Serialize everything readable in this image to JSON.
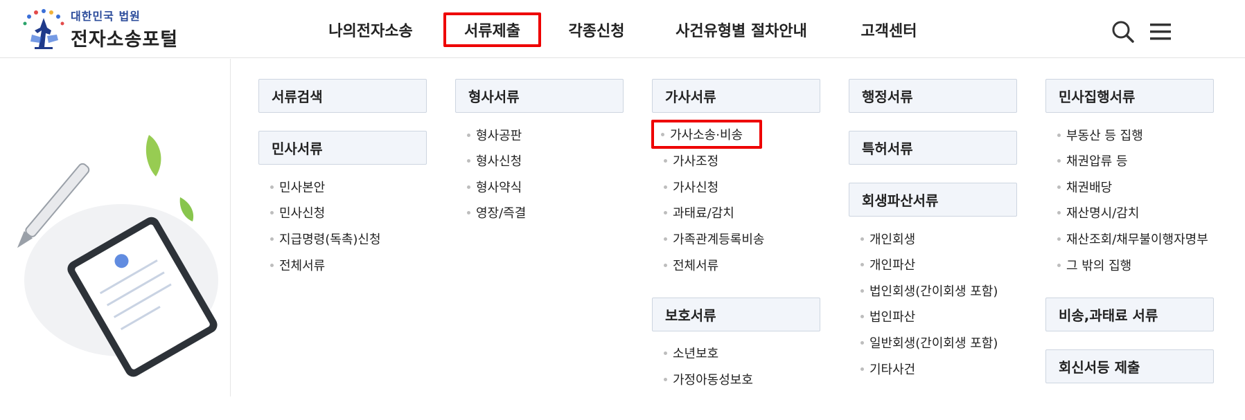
{
  "header": {
    "logo_sub": "대한민국 법원",
    "logo_main": "전자소송포털",
    "nav": [
      {
        "label": "나의전자소송",
        "active": false
      },
      {
        "label": "서류제출",
        "active": true
      },
      {
        "label": "각종신청",
        "active": false
      },
      {
        "label": "사건유형별 절차안내",
        "active": false
      },
      {
        "label": "고객센터",
        "active": false
      }
    ],
    "icons": [
      "search-icon",
      "hamburger-menu-icon"
    ]
  },
  "menu": {
    "col1": {
      "search_box": "서류검색",
      "civil": {
        "title": "민사서류",
        "items": [
          "민사본안",
          "민사신청",
          "지급명령(독촉)신청",
          "전체서류"
        ]
      }
    },
    "col2": {
      "criminal": {
        "title": "형사서류",
        "items": [
          "형사공판",
          "형사신청",
          "형사약식",
          "영장/즉결"
        ]
      }
    },
    "col3": {
      "family": {
        "title": "가사서류",
        "items": [
          "가사소송·비송",
          "가사조정",
          "가사신청",
          "과태료/감치",
          "가족관계등록비송",
          "전체서류"
        ],
        "highlighted_item": "가사소송·비송"
      },
      "protection": {
        "title": "보호서류",
        "items": [
          "소년보호",
          "가정아동성보호"
        ]
      }
    },
    "col4": {
      "administrative": {
        "title": "행정서류"
      },
      "patent": {
        "title": "특허서류"
      },
      "rehab": {
        "title": "회생파산서류",
        "items": [
          "개인회생",
          "개인파산",
          "법인회생(간이회생 포함)",
          "법인파산",
          "일반회생(간이회생 포함)",
          "기타사건"
        ]
      }
    },
    "col5": {
      "civil_exec": {
        "title": "민사집행서류",
        "items": [
          "부동산 등 집행",
          "채권압류 등",
          "채권배당",
          "재산명시/감치",
          "재산조회/채무불이행자명부",
          "그 밖의 집행"
        ]
      },
      "noncontentious": {
        "title": "비송,과태료 서류"
      },
      "reply": {
        "title": "회신서등 제출"
      }
    }
  },
  "colors": {
    "highlight_border": "#ee0000",
    "box_bg": "#f2f5fa",
    "box_border": "#cdd5e0",
    "logo_blue": "#2a4a9a"
  }
}
